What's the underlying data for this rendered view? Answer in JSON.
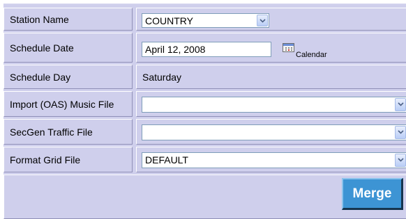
{
  "form": {
    "station_name": {
      "label": "Station Name",
      "value": "COUNTRY"
    },
    "schedule_date": {
      "label": "Schedule Date",
      "value": "April 12, 2008",
      "calendar_label": "Calendar",
      "icon": "calendar-icon"
    },
    "schedule_day": {
      "label": "Schedule Day",
      "value": "Saturday"
    },
    "music_file": {
      "label": "Import (OAS) Music File",
      "value": ""
    },
    "traffic_file": {
      "label": "SecGen Traffic File",
      "value": ""
    },
    "format_grid": {
      "label": "Format Grid File",
      "value": "DEFAULT"
    }
  },
  "actions": {
    "merge_label": "Merge"
  },
  "colors": {
    "panel": "#cfcfec",
    "button": "#3d94d4",
    "button_text": "#ffffff"
  }
}
